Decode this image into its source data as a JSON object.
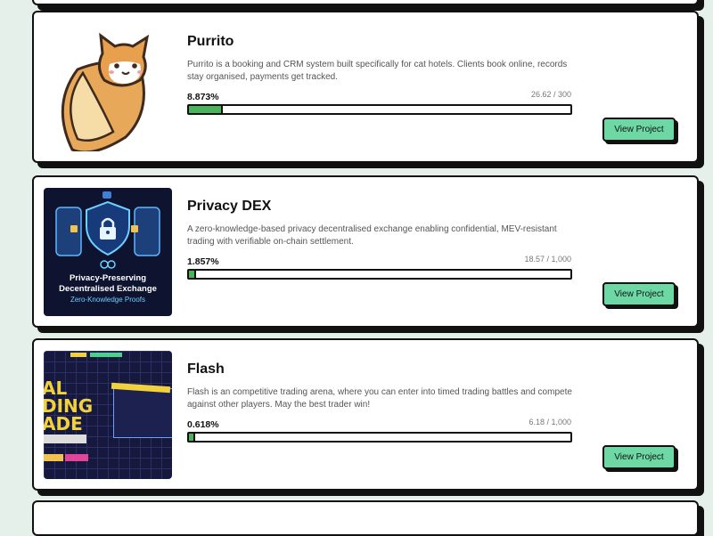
{
  "projects": [
    {
      "title": "Purrito",
      "description": "Purrito is a booking and CRM system built specifically for cat hotels. Clients book online, records stay organised, payments get tracked.",
      "percent_label": "8.873%",
      "progress": 0.08873,
      "amount": "26.62 / 300",
      "button": "View Project"
    },
    {
      "title": "Privacy DEX",
      "description": "A zero-knowledge-based privacy decentralised exchange enabling confidential, MEV-resistant trading with verifiable on-chain settlement.",
      "percent_label": "1.857%",
      "progress": 0.01857,
      "amount": "18.57 / 1,000",
      "button": "View Project",
      "image_text": {
        "line1": "Privacy-Preserving",
        "line2": "Decentralised Exchange",
        "line3": "Zero-Knowledge Proofs"
      }
    },
    {
      "title": "Flash",
      "description": "Flash is an competitive trading arena, where you can enter into timed trading battles and compete against other players. May the best trader win!",
      "percent_label": "0.618%",
      "progress": 0.00618,
      "amount": "6.18 / 1,000",
      "button": "View Project",
      "image_text": {
        "big1": "AL",
        "big2": "DING",
        "big3": "ADE"
      }
    }
  ],
  "colors": {
    "background": "#e4f0e9",
    "progress_fill": "#4bb35c",
    "button": "#6dd8a4",
    "dex_bg": "#0e1330",
    "flash_bg": "#16193d"
  }
}
